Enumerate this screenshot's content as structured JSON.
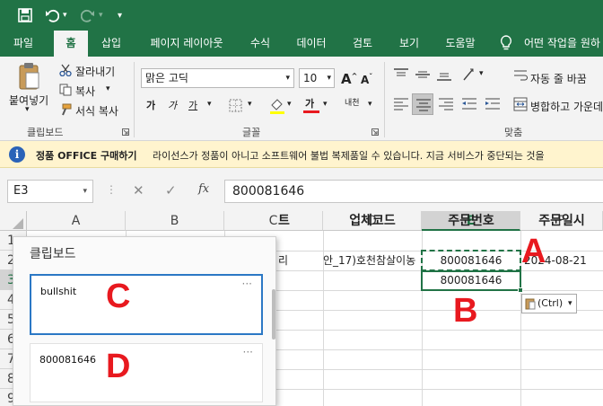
{
  "menu": {
    "tabs": [
      "파일",
      "홈",
      "삽입",
      "페이지 레이아웃",
      "수식",
      "데이터",
      "검토",
      "보기",
      "도움말"
    ],
    "active_tab": 1,
    "tell_me": "어떤 작업을 원하"
  },
  "ribbon": {
    "paste": "붙여넣기",
    "cut": "잘라내기",
    "copy": "복사",
    "format_painter": "서식 복사",
    "clipboard_group": "클립보드",
    "font_name": "맑은 고딕",
    "font_size": "10",
    "bold": "가",
    "italic": "가",
    "underline": "가",
    "phonetic": "내천",
    "font_color_glyph": "가",
    "font_group": "글꼴",
    "wrap_text": "자동 줄 바꿈",
    "merge_center": "병합하고 가운데",
    "align_group": "맞춤"
  },
  "license": {
    "title": "정품 OFFICE 구매하기",
    "message": "라이선스가 정품이 아니고 소프트웨어 불법 복제품일 수 있습니다. 지금 서비스가 중단되는 것을"
  },
  "formula": {
    "name_box": "E3",
    "fx": "fx",
    "value": "800081646"
  },
  "grid": {
    "columns": [
      "A",
      "B",
      "C",
      "D",
      "E",
      "F"
    ],
    "selected_column": "E",
    "rows": [
      "1",
      "2",
      "3",
      "4",
      "5",
      "6",
      "7",
      "8",
      "9"
    ],
    "selected_row": "3",
    "row1": {
      "C": "트",
      "D": "업체코드",
      "E": "주문번호",
      "F": "주문일시"
    },
    "row2": {
      "C": "리",
      "D": "안_17)호천참살이농",
      "E": "800081646",
      "F": "2024-08-21"
    },
    "row3": {
      "E": "800081646"
    }
  },
  "clipboard_pane": {
    "title": "클립보드",
    "items": [
      {
        "text": "bullshit",
        "more": "···"
      },
      {
        "text": "800081646",
        "more": "···"
      }
    ]
  },
  "paste_options": "(Ctrl)",
  "annotations": [
    "A",
    "B",
    "C",
    "D"
  ],
  "colors": {
    "excel_green": "#217346",
    "annotation_red": "#e8191f",
    "selection_blue": "#2b78c5"
  }
}
